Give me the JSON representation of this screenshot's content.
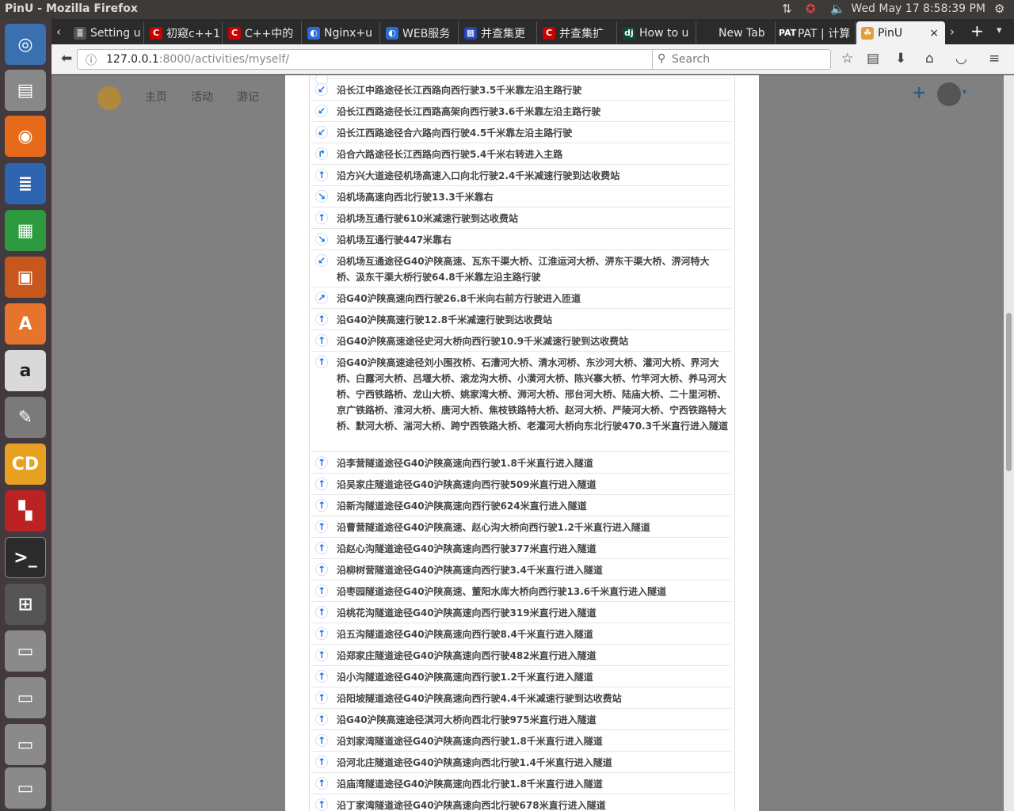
{
  "window": {
    "title": "PinU - Mozilla Firefox",
    "clock": "Wed May 17  8:58:39 PM"
  },
  "tabs": [
    {
      "label": "Setting u",
      "fav": "≣",
      "color": "#555"
    },
    {
      "label": "初窥c++1",
      "fav": "C",
      "color": "#c00"
    },
    {
      "label": "C++中的",
      "fav": "C",
      "color": "#c00"
    },
    {
      "label": "Nginx+u",
      "fav": "◐",
      "color": "#2a6bd8"
    },
    {
      "label": "WEB服务",
      "fav": "◐",
      "color": "#2a6bd8"
    },
    {
      "label": "并查集更",
      "fav": "▦",
      "color": "#2244bb"
    },
    {
      "label": "并查集扩",
      "fav": "C",
      "color": "#c00"
    },
    {
      "label": "How to u",
      "fav": "dj",
      "color": "#0c4b33"
    },
    {
      "label": "New Tab",
      "fav": "",
      "color": "#2b2b2b"
    },
    {
      "label": "PAT | 计算",
      "fav": "PAT",
      "color": "#333"
    },
    {
      "label": "PinU",
      "fav": "☘",
      "color": "#e0a040"
    }
  ],
  "nav": {
    "url_host": "127.0.0.1",
    "url_path": ":8000/activities/myself/",
    "search_placeholder": "Search"
  },
  "site": {
    "menu": [
      "主页",
      "活动",
      "游记"
    ]
  },
  "steps": [
    {
      "d": "",
      "t": ""
    },
    {
      "d": "↙",
      "t": "沿长江中路途径长江西路向西行驶3.5千米靠左沿主路行驶"
    },
    {
      "d": "↙",
      "t": "沿长江西路途径长江西路高架向西行驶3.6千米靠左沿主路行驶"
    },
    {
      "d": "↙",
      "t": "沿长江西路途径合六路向西行驶4.5千米靠左沿主路行驶"
    },
    {
      "d": "↱",
      "t": "沿合六路途径长江西路向西行驶5.4千米右转进入主路"
    },
    {
      "d": "↑",
      "t": "沿方兴大道途径机场高速入口向北行驶2.4千米减速行驶到达收费站"
    },
    {
      "d": "↘",
      "t": "沿机场高速向西北行驶13.3千米靠右"
    },
    {
      "d": "↑",
      "t": "沿机场互通行驶610米减速行驶到达收费站"
    },
    {
      "d": "↘",
      "t": "沿机场互通行驶447米靠右"
    },
    {
      "d": "↙",
      "t": "沿机场互通途径G40沪陕高速、瓦东干渠大桥、江淮运河大桥、淠东干渠大桥、淠河特大桥、汲东干渠大桥行驶64.8千米靠左沿主路行驶"
    },
    {
      "d": "↗",
      "t": "沿G40沪陕高速向西行驶26.8千米向右前方行驶进入匝道"
    },
    {
      "d": "↑",
      "t": "沿G40沪陕高速行驶12.8千米减速行驶到达收费站"
    },
    {
      "d": "↑",
      "t": "沿G40沪陕高速途径史河大桥向西行驶10.9千米减速行驶到达收费站"
    },
    {
      "d": "↑",
      "t": "沿G40沪陕高速途径刘小围孜桥、石漕河大桥、清水河桥、东沙河大桥、灌河大桥、界河大桥、白露河大桥、吕堰大桥、滚龙沟大桥、小潢河大桥、陈兴寨大桥、竹竿河大桥、养马河大桥、宁西铁路桥、龙山大桥、姚家湾大桥、浉河大桥、邢台河大桥、陆庙大桥、二十里河桥、京广铁路桥、淮河大桥、唐河大桥、焦枝铁路特大桥、赵河大桥、严陵河大桥、宁西铁路特大桥、默河大桥、湍河大桥、跨宁西铁路大桥、老灌河大桥向东北行驶470.3千米直行进入隧道"
    },
    {
      "d": "↑",
      "t": "沿李营隧道途径G40沪陕高速向西行驶1.8千米直行进入隧道"
    },
    {
      "d": "↑",
      "t": "沿吴家庄隧道途径G40沪陕高速向西行驶509米直行进入隧道"
    },
    {
      "d": "↑",
      "t": "沿新沟隧道途径G40沪陕高速向西行驶624米直行进入隧道"
    },
    {
      "d": "↑",
      "t": "沿曹营隧道途径G40沪陕高速、赵心沟大桥向西行驶1.2千米直行进入隧道"
    },
    {
      "d": "↑",
      "t": "沿赵心沟隧道途径G40沪陕高速向西行驶377米直行进入隧道"
    },
    {
      "d": "↑",
      "t": "沿柳树营隧道途径G40沪陕高速向西行驶3.4千米直行进入隧道"
    },
    {
      "d": "↑",
      "t": "沿枣园隧道途径G40沪陕高速、董阳水库大桥向西行驶13.6千米直行进入隧道"
    },
    {
      "d": "↑",
      "t": "沿桃花沟隧道途径G40沪陕高速向西行驶319米直行进入隧道"
    },
    {
      "d": "↑",
      "t": "沿五沟隧道途径G40沪陕高速向西行驶8.4千米直行进入隧道"
    },
    {
      "d": "↑",
      "t": "沿郑家庄隧道途径G40沪陕高速向西行驶482米直行进入隧道"
    },
    {
      "d": "↑",
      "t": "沿小沟隧道途径G40沪陕高速向西行驶1.2千米直行进入隧道"
    },
    {
      "d": "↑",
      "t": "沿阳坡隧道途径G40沪陕高速向西行驶4.4千米减速行驶到达收费站"
    },
    {
      "d": "↑",
      "t": "沿G40沪陕高速途径淇河大桥向西北行驶975米直行进入隧道"
    },
    {
      "d": "↑",
      "t": "沿刘家湾隧道途径G40沪陕高速向西行驶1.8千米直行进入隧道"
    },
    {
      "d": "↑",
      "t": "沿河北庄隧道途径G40沪陕高速向西北行驶1.4千米直行进入隧道"
    },
    {
      "d": "↑",
      "t": "沿庙湾隧道途径G40沪陕高速向西北行驶1.8千米直行进入隧道"
    },
    {
      "d": "↑",
      "t": "沿丁家湾隧道途径G40沪陕高速向西北行驶678米直行进入隧道"
    }
  ]
}
